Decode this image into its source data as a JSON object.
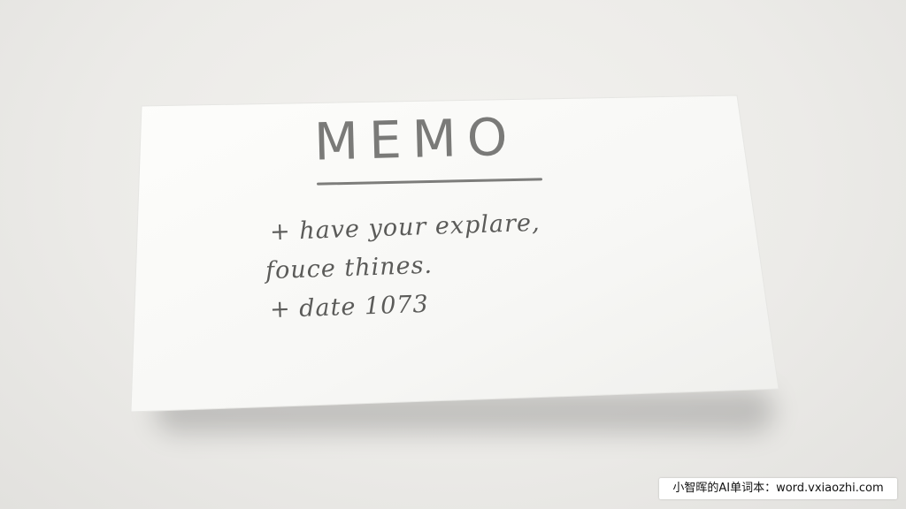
{
  "memo": {
    "title": "MEMO",
    "lines": [
      "+ have your explare,",
      "fouce thines.",
      "+ date 1073"
    ]
  },
  "watermark": {
    "text": "小智晖的AI单词本：word.vxiaozhi.com"
  },
  "colors": {
    "paper": "#fbfbf9",
    "ink": "#5b5b59",
    "background": "#ecebe8"
  }
}
